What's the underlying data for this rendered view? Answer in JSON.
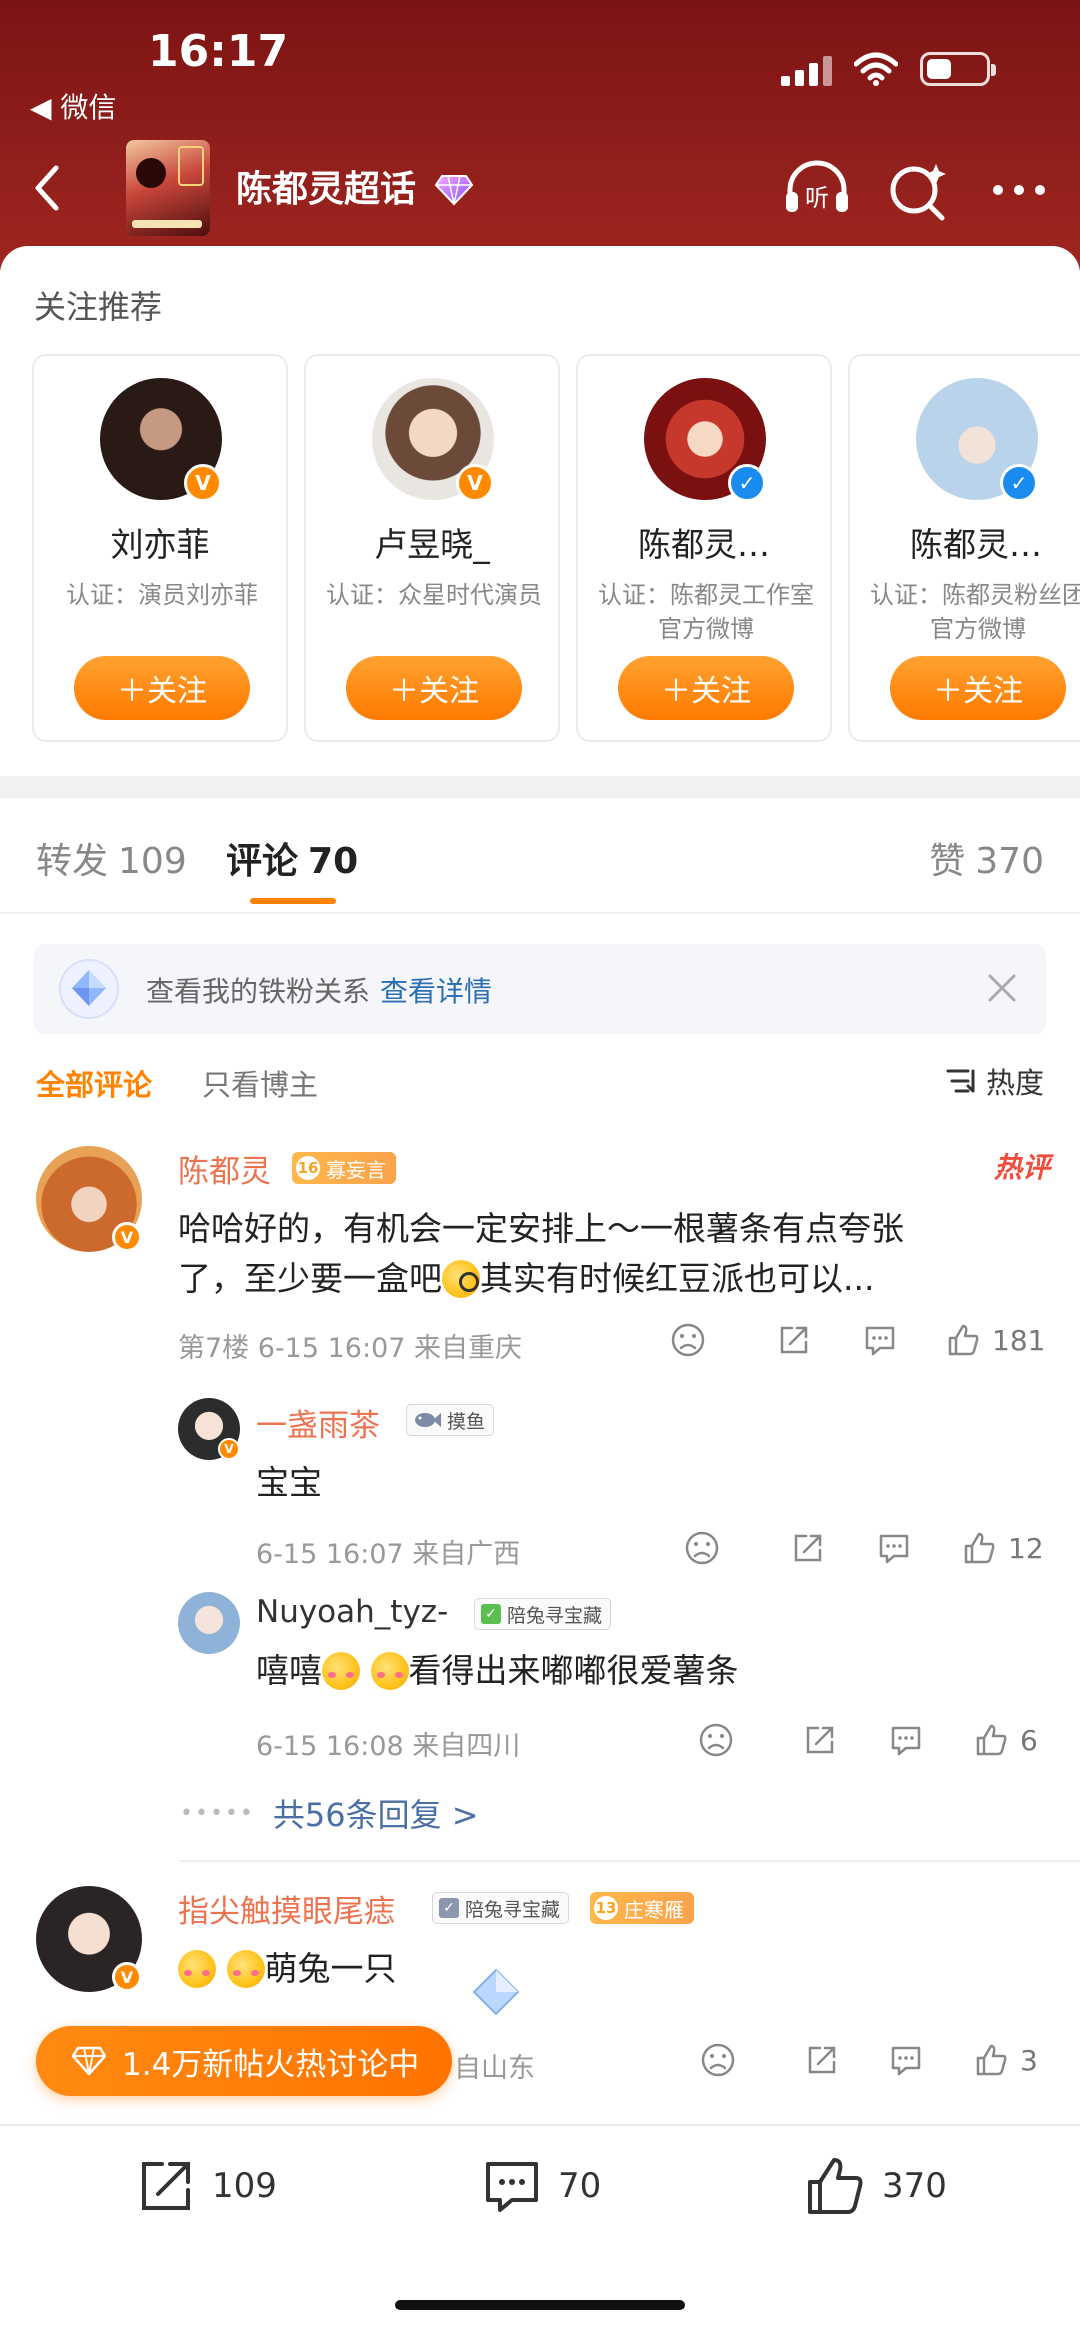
{
  "status": {
    "time": "16:17",
    "back_app": "◀ 微信"
  },
  "topic": {
    "title": "陈都灵超话"
  },
  "recommend": {
    "title": "关注推荐",
    "cards": [
      {
        "name": "刘亦菲",
        "cert": "认证：演员刘亦菲",
        "follow": "＋关注",
        "badge": "V"
      },
      {
        "name": "卢昱晓_",
        "cert": "认证：众星时代演员",
        "follow": "＋关注",
        "badge": "V"
      },
      {
        "name": "陈都灵…",
        "cert": "认证：陈都灵工作室官方微博",
        "follow": "＋关注",
        "badge": "✓"
      },
      {
        "name": "陈都灵…",
        "cert": "认证：陈都灵粉丝团官方微博",
        "follow": "＋关注",
        "badge": "✓"
      }
    ]
  },
  "tabs": {
    "repost_label": "转发",
    "repost_count": "109",
    "comment_label": "评论",
    "comment_count": "70",
    "like_label": "赞",
    "like_count": "370"
  },
  "fan_banner": {
    "text": "查看我的铁粉关系",
    "link": "查看详情"
  },
  "filter": {
    "all": "全部评论",
    "blogger": "只看博主",
    "sort": "热度"
  },
  "comments": [
    {
      "name": "陈都灵",
      "level": "16",
      "title_badge": "寡妄言",
      "hot": "热评",
      "text_1": "哈哈好的，有机会一定安排上～一根薯条有点夸张",
      "text_2": "了，至少要一盒吧",
      "text_3": "其实有时候红豆派也可以...",
      "meta": "第7楼 6-15 16:07 来自重庆",
      "likes": "181",
      "replies": [
        {
          "name": "一盏雨茶",
          "tag": "摸鱼",
          "text": "宝宝",
          "meta": "6-15 16:07 来自广西",
          "likes": "12"
        },
        {
          "name": "Nuyoah_tyz-",
          "tag": "陪兔寻宝藏",
          "text": "嘻嘻",
          "text_tail": "看得出来嘟嘟很爱薯条",
          "meta": "6-15 16:08 来自四川",
          "likes": "6"
        }
      ],
      "more": "共56条回复 >"
    },
    {
      "name": "指尖触摸眼尾痣",
      "tag": "陪兔寻宝藏",
      "level": "13",
      "title_badge": "庄寒雁",
      "text": "萌兔一只",
      "meta": "自山东",
      "likes": "3"
    }
  ],
  "floating": {
    "label": "1.4万新帖火热讨论中"
  },
  "bottom_bar": {
    "repost": "109",
    "comment": "70",
    "like": "370"
  },
  "colors": {
    "accent": "#ff8200",
    "header": "#8f1e1c",
    "link": "#2d6fb3",
    "name": "#eb7350"
  }
}
